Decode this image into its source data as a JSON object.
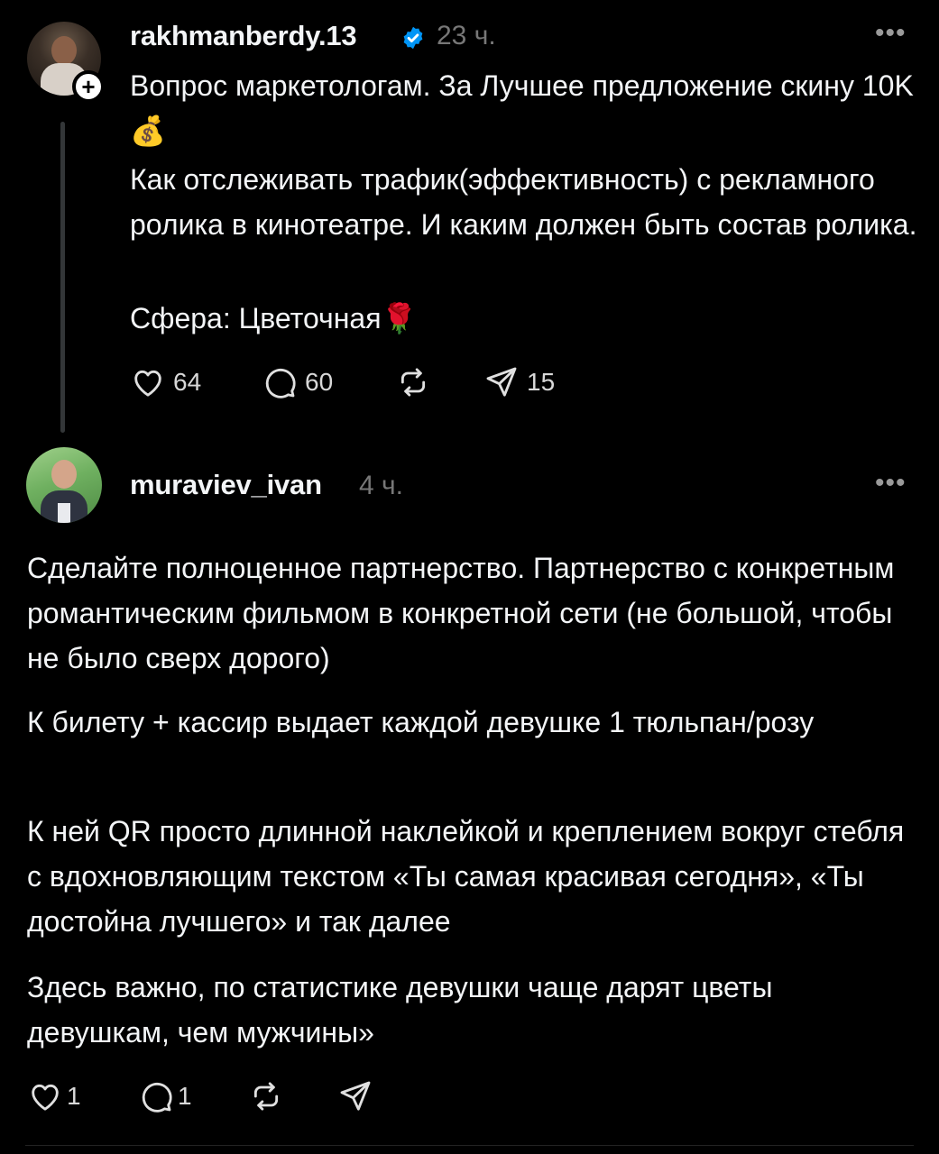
{
  "posts": [
    {
      "username": "rakhmanberdy.13",
      "verified": true,
      "time": "23 ч.",
      "more": "•••",
      "follow_symbol": "+",
      "paragraphs": [
        "Вопрос маркетологам. За Лучшее предложение скину 10K💰",
        "Как отслеживать трафик(эффективность) с рекламного ролика в кинотеатре. И каким должен быть состав ролика.",
        "Сфера: Цветочная🌹"
      ],
      "actions": {
        "likes": "64",
        "comments": "60",
        "reposts": "",
        "shares": "15"
      }
    },
    {
      "username": "muraviev_ivan",
      "verified": false,
      "time": "4 ч.",
      "more": "•••",
      "paragraphs": [
        "Сделайте полноценное партнерство. Партнерство с конкретным романтическим фильмом в конкретной сети (не большой, чтобы не было сверх дорого)",
        "К билету + кассир выдает каждой девушке 1 тюльпан/розу",
        "К ней QR просто длинной наклейкой и креплением вокруг стебля с вдохновляющим текстом «Ты самая красивая сегодня», «Ты достойна лучшего» и так далее",
        "Здесь важно, по статистике девушки чаще дарят цветы девушкам, чем мужчины»"
      ],
      "actions": {
        "likes": "1",
        "comments": "1",
        "reposts": "",
        "shares": ""
      }
    }
  ],
  "colors": {
    "background": "#000000",
    "text": "#f3f5f7",
    "muted": "#777777",
    "verified": "#0095f6"
  },
  "icons": [
    "heart-icon",
    "comment-icon",
    "repost-icon",
    "share-icon",
    "verified-icon",
    "more-icon",
    "plus-icon"
  ]
}
